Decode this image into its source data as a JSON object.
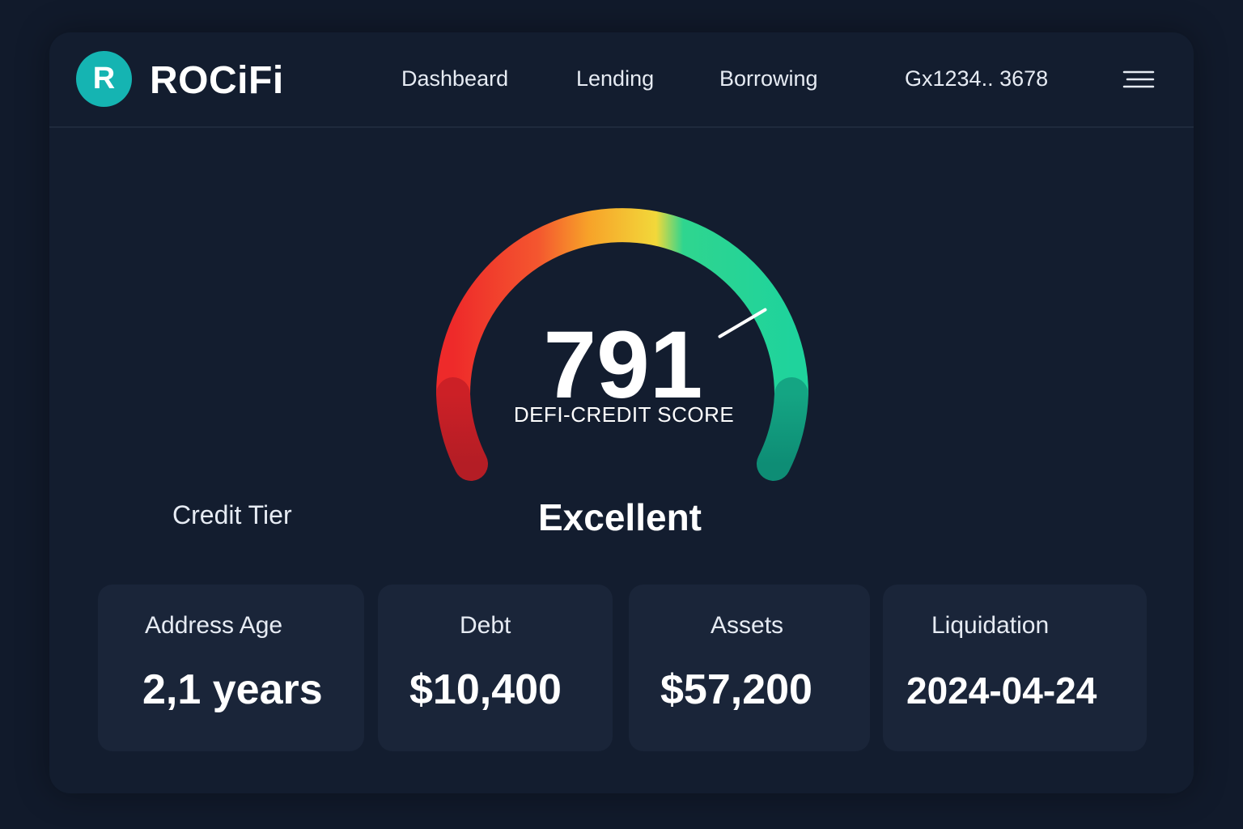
{
  "header": {
    "logo_letter": "R",
    "brand": "ROCiFi",
    "nav": [
      "Dashbeard",
      "Lending",
      "Borrowing"
    ],
    "wallet": "Gx1234.. 3678"
  },
  "gauge": {
    "score": "791",
    "label": "DEFI-CREDIT SCORE",
    "score_fraction": 0.83
  },
  "tier": {
    "label": "Credit Tier",
    "value": "Excellent"
  },
  "cards": [
    {
      "label": "Address Age",
      "value": "2,1 years"
    },
    {
      "label": "Debt",
      "value": "$10,400"
    },
    {
      "label": "Assets",
      "value": "$57,200"
    },
    {
      "label": "Liquidation",
      "value": "2024-04-24"
    }
  ],
  "colors": {
    "brand": "#15b4b2",
    "background": "#111a2b",
    "card": "#1a2539",
    "gauge_red": "#ee2a2a",
    "gauge_orange": "#f7a229",
    "gauge_yellow": "#f2d83a",
    "gauge_green": "#1fd39c"
  },
  "icons": {
    "menu": "hamburger-menu-icon"
  }
}
